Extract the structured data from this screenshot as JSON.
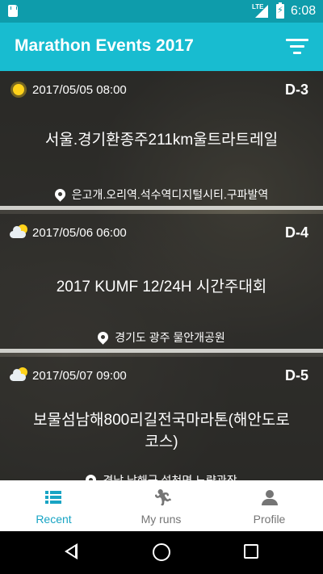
{
  "status_bar": {
    "time": "6:08",
    "network": "LTE",
    "icons": [
      "sd-card-icon",
      "signal-icon",
      "battery-charging-icon"
    ]
  },
  "app_bar": {
    "title": "Marathon Events 2017",
    "filter_icon": "filter-icon"
  },
  "events": [
    {
      "weather": "sun-icon",
      "date": "2017/05/05 08:00",
      "dday": "D-3",
      "name": "서울.경기환종주211km울트라트레일",
      "location": "은고개.오리역.석수역디지털시티.구파발역"
    },
    {
      "weather": "cloud-sun-icon",
      "date": "2017/05/06 06:00",
      "dday": "D-4",
      "name": "2017 KUMF 12/24H 시간주대회",
      "location": "경기도 광주 물안개공원"
    },
    {
      "weather": "cloud-sun-icon",
      "date": "2017/05/07 09:00",
      "dday": "D-5",
      "name": "보물섬남해800리길전국마라톤(해안도로코스)",
      "location": "경남 남해군 설천면 노량관장"
    }
  ],
  "bottom_nav": {
    "items": [
      {
        "label": "Recent",
        "icon": "list-icon",
        "active": true
      },
      {
        "label": "My runs",
        "icon": "runner-icon",
        "active": false
      },
      {
        "label": "Profile",
        "icon": "person-icon",
        "active": false
      }
    ],
    "active_color": "#18a4c4",
    "inactive_color": "#757575"
  },
  "colors": {
    "app_bar": "#18bcd0",
    "status_bar": "#0e9cab"
  }
}
